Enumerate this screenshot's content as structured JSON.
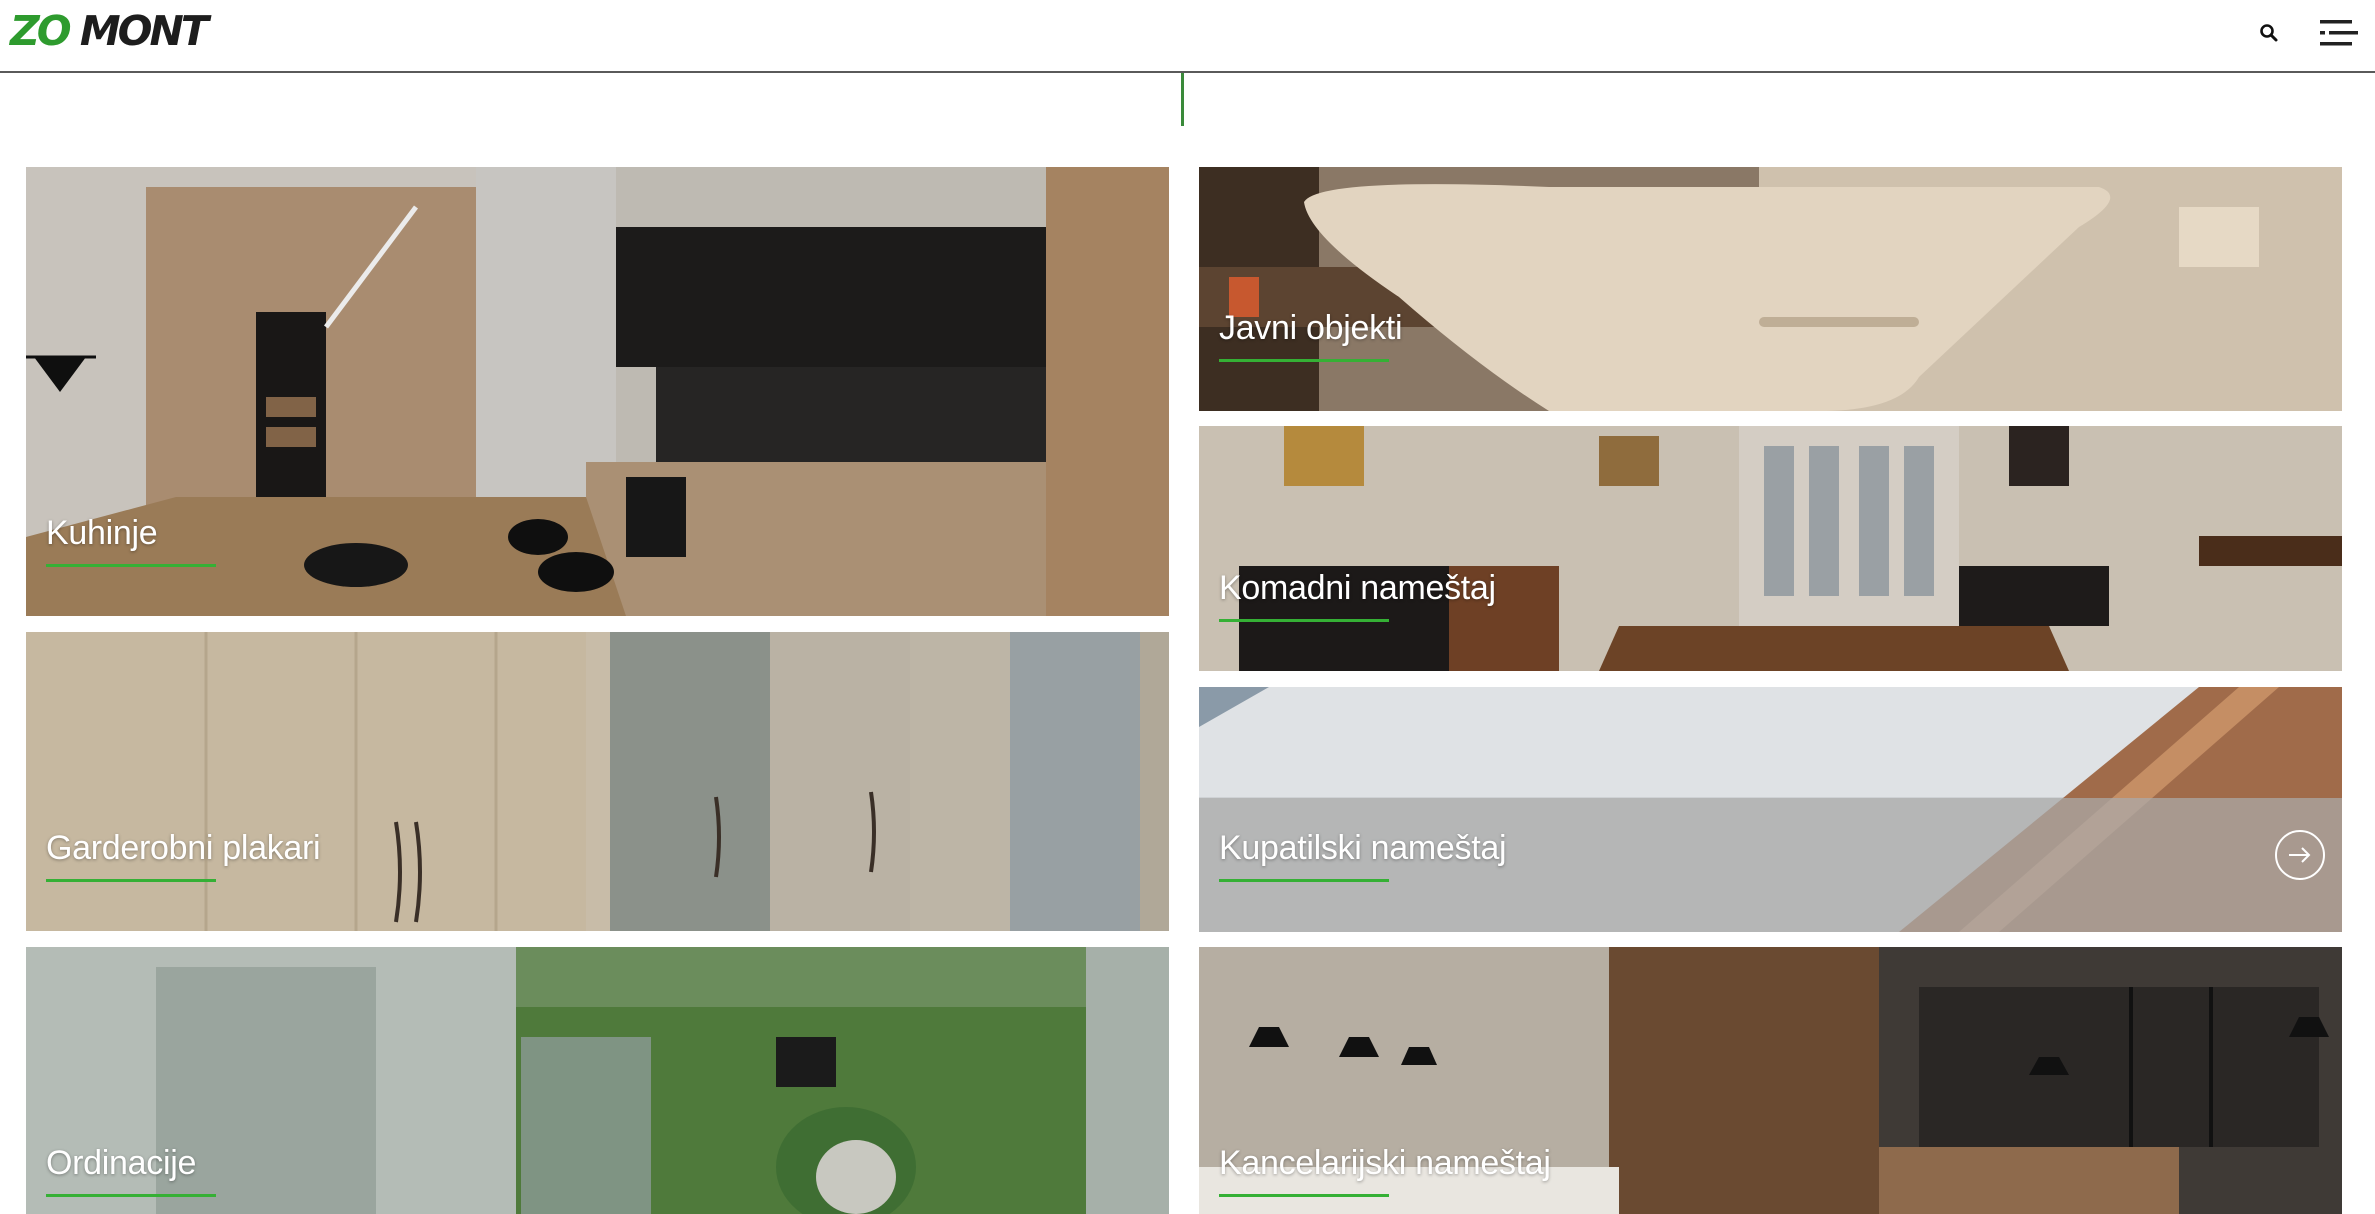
{
  "header": {
    "logo_part1": "ZO",
    "logo_part2": "MONT",
    "search_icon": "search-icon",
    "menu_icon": "menu-icon"
  },
  "colors": {
    "accent_green": "#35b035",
    "header_border": "#5a5a5a"
  },
  "tiles": [
    {
      "label": "Kuhinje"
    },
    {
      "label": "Garderobni plakari"
    },
    {
      "label": "Ordinacije"
    },
    {
      "label": "Javni objekti"
    },
    {
      "label": "Komadni nameštaj"
    },
    {
      "label": "Kupatilski nameštaj"
    },
    {
      "label": "Kancelarijski nameštaj"
    }
  ],
  "active_tile": "Kupatilski nameštaj",
  "tile_arrow_icon": "arrow-right-circle-icon"
}
